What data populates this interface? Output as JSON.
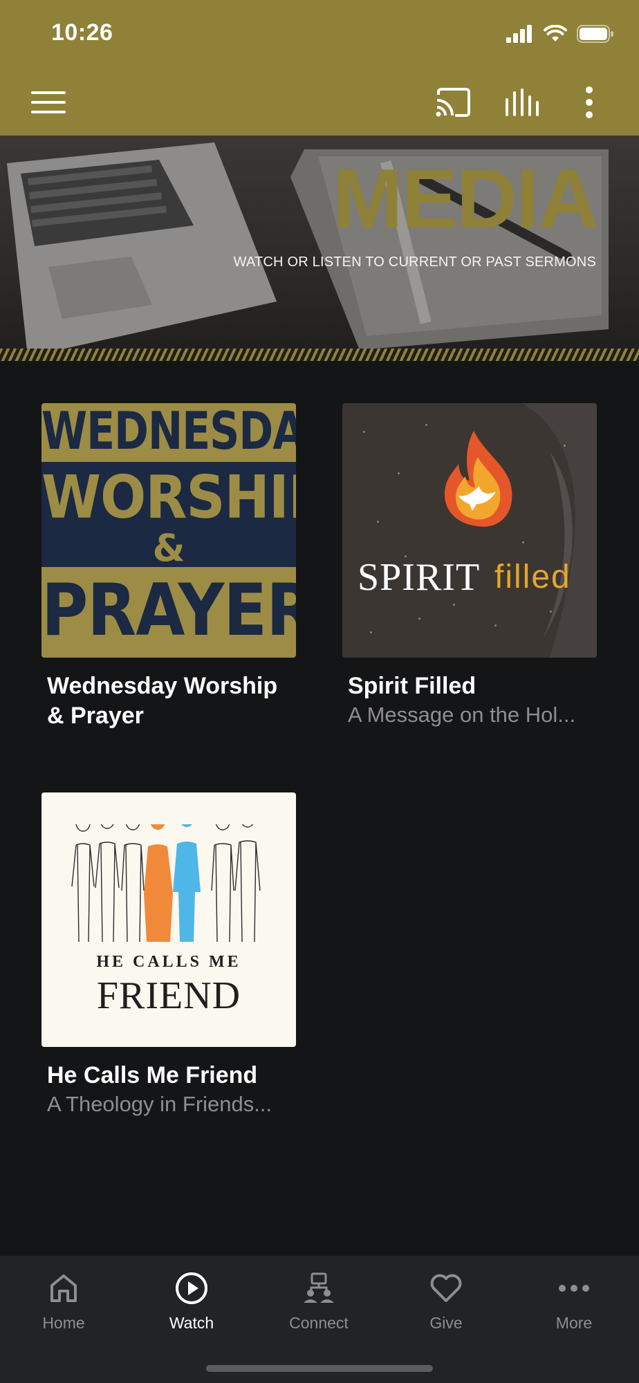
{
  "status": {
    "time": "10:26"
  },
  "appbar": {
    "icons": [
      "menu-icon",
      "cast-icon",
      "audio-bars-icon",
      "more-vertical-icon"
    ]
  },
  "hero": {
    "title": "MEDIA",
    "subtitle": "WATCH OR LISTEN TO CURRENT OR PAST SERMONS"
  },
  "cards": [
    {
      "title": "Wednesday Worship & Prayer",
      "subtitle": "",
      "art": {
        "line1": "WEDNESDAY",
        "line2": "WORSHIP",
        "line3": "&",
        "line4": "PRAYER"
      }
    },
    {
      "title": "Spirit Filled",
      "subtitle": "A Message on the Hol...",
      "art": {
        "word1": "SPIRIT",
        "word2": "filled"
      }
    },
    {
      "title": "He Calls Me Friend",
      "subtitle": "A Theology in Friends...",
      "art": {
        "line1": "HE CALLS ME",
        "line2": "FRIEND"
      }
    }
  ],
  "tabs": [
    {
      "label": "Home",
      "icon": "home-icon",
      "active": false
    },
    {
      "label": "Watch",
      "icon": "play-circle-icon",
      "active": true
    },
    {
      "label": "Connect",
      "icon": "connect-icon",
      "active": false
    },
    {
      "label": "Give",
      "icon": "heart-icon",
      "active": false
    },
    {
      "label": "More",
      "icon": "more-horizontal-icon",
      "active": false
    }
  ],
  "colors": {
    "brand": "#8f8137",
    "background": "#141517",
    "tabbar": "#222325",
    "muted": "#8e8e92"
  }
}
